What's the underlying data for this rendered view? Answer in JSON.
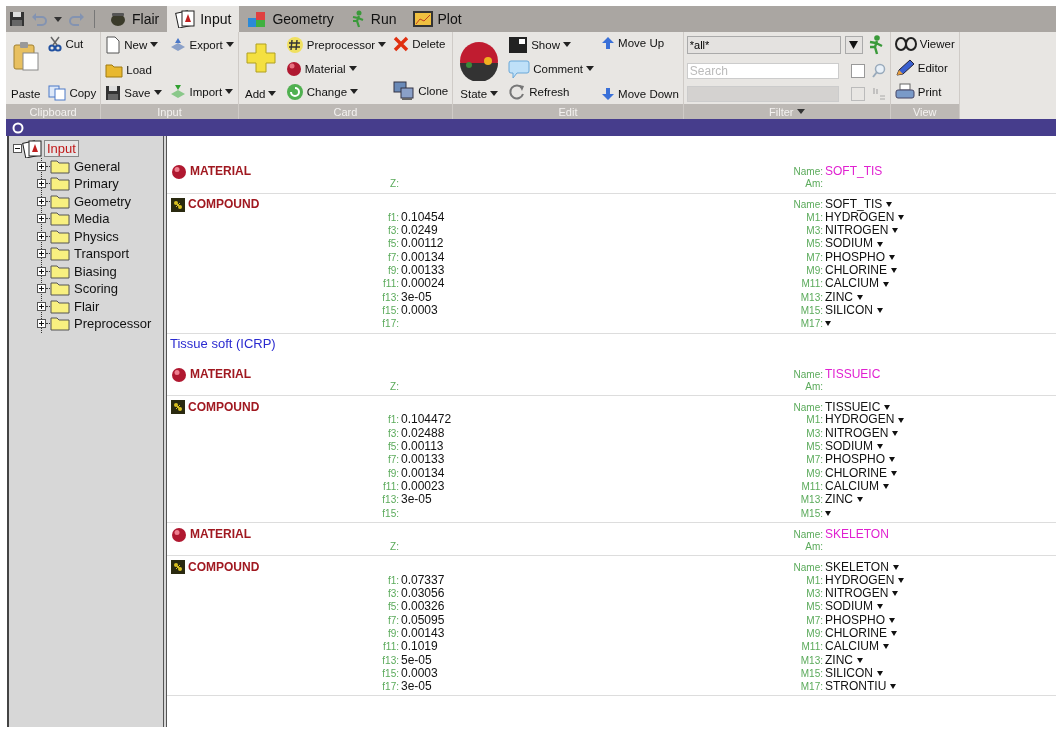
{
  "quick_access": [
    {
      "kind": "save",
      "disabled": false
    },
    {
      "kind": "undo",
      "disabled": true
    },
    {
      "kind": "dropdown",
      "disabled": false
    },
    {
      "kind": "redo",
      "disabled": true
    }
  ],
  "tabs": [
    {
      "label": "Flair",
      "kind": "flair",
      "selected": false
    },
    {
      "label": "Input",
      "kind": "input",
      "selected": true
    },
    {
      "label": "Geometry",
      "kind": "geometry",
      "selected": false
    },
    {
      "label": "Run",
      "kind": "run",
      "selected": false
    },
    {
      "label": "Plot",
      "kind": "plot",
      "selected": false
    }
  ],
  "ribbon": {
    "groups": [
      {
        "label": "Clipboard",
        "kind": "buttons",
        "columns": [
          [
            {
              "label": "Paste",
              "kind": "paste",
              "large": true,
              "dropdown": false
            }
          ],
          [
            {
              "label": "Cut",
              "kind": "cut",
              "large": false,
              "dropdown": false
            },
            {
              "label": "Copy",
              "kind": "copy",
              "large": false,
              "dropdown": false
            }
          ]
        ]
      },
      {
        "label": "Input",
        "kind": "buttons",
        "columns": [
          [
            {
              "label": "New",
              "kind": "new",
              "large": false,
              "dropdown": true
            },
            {
              "label": "Load",
              "kind": "load",
              "large": false,
              "dropdown": false
            },
            {
              "label": "Save",
              "kind": "save",
              "large": false,
              "dropdown": true
            }
          ],
          [
            {
              "label": "Export",
              "kind": "export",
              "large": false,
              "dropdown": true
            },
            {
              "label": "Import",
              "kind": "import",
              "large": false,
              "dropdown": true
            }
          ]
        ]
      },
      {
        "label": "Card",
        "kind": "buttons",
        "columns": [
          [
            {
              "label": "Add",
              "kind": "add",
              "large": true,
              "dropdown": true
            }
          ],
          [
            {
              "label": "Preprocessor",
              "kind": "preprocessor",
              "large": false,
              "dropdown": true
            },
            {
              "label": "Material",
              "kind": "material",
              "large": false,
              "dropdown": true
            },
            {
              "label": "Change",
              "kind": "change",
              "large": false,
              "dropdown": true
            }
          ],
          [
            {
              "label": "Delete",
              "kind": "delete",
              "large": false,
              "dropdown": false
            },
            {
              "label": "Clone",
              "kind": "clone",
              "large": false,
              "dropdown": false
            }
          ]
        ]
      },
      {
        "label": "Edit",
        "kind": "buttons",
        "columns": [
          [
            {
              "label": "State",
              "kind": "state",
              "large": true,
              "dropdown": true
            }
          ],
          [
            {
              "label": "Show",
              "kind": "show",
              "large": false,
              "dropdown": true
            },
            {
              "label": "Comment",
              "kind": "comment",
              "large": false,
              "dropdown": true
            },
            {
              "label": "Refresh",
              "kind": "refresh",
              "large": false,
              "dropdown": false
            }
          ],
          [
            {
              "label": "Move Up",
              "kind": "move-up",
              "large": false,
              "dropdown": false
            },
            {
              "label": "Move Down",
              "kind": "move-down",
              "large": false,
              "dropdown": false
            }
          ]
        ]
      },
      {
        "label": "Filter",
        "kind": "filter",
        "dropdown": true,
        "combo": {
          "value": "*all*"
        },
        "search": {
          "placeholder": "Search",
          "checked": false
        },
        "pattern": {
          "disabled": true,
          "checked": false
        }
      },
      {
        "label": "View",
        "kind": "buttons",
        "columns": [
          [
            {
              "label": "Viewer",
              "kind": "viewer",
              "large": false,
              "dropdown": false
            },
            {
              "label": "Editor",
              "kind": "editor",
              "large": false,
              "dropdown": false
            },
            {
              "label": "Print",
              "kind": "print",
              "large": false,
              "dropdown": false
            }
          ]
        ]
      }
    ]
  },
  "tree": {
    "label": "Input",
    "expanded": true,
    "selected": true,
    "children": [
      {
        "label": "General",
        "expanded": false,
        "selected": false
      },
      {
        "label": "Primary",
        "expanded": false,
        "selected": false
      },
      {
        "label": "Geometry",
        "expanded": false,
        "selected": false
      },
      {
        "label": "Media",
        "expanded": false,
        "selected": false
      },
      {
        "label": "Physics",
        "expanded": false,
        "selected": false
      },
      {
        "label": "Transport",
        "expanded": false,
        "selected": false
      },
      {
        "label": "Biasing",
        "expanded": false,
        "selected": false
      },
      {
        "label": "Scoring",
        "expanded": false,
        "selected": false
      },
      {
        "label": "Flair",
        "expanded": false,
        "selected": false
      },
      {
        "label": "Preprocessor",
        "expanded": false,
        "selected": false
      }
    ]
  },
  "cards": [
    {
      "kind": "material",
      "title": "MATERIAL",
      "lines": [
        {
          "right": {
            "label": "Name:",
            "value": "SOFT_TIS",
            "kind": "name"
          }
        },
        {
          "mid": {
            "label": "Z:"
          },
          "right": {
            "label": "Am:",
            "kind": "plain"
          }
        }
      ]
    },
    {
      "kind": "compound",
      "title": "COMPOUND",
      "lines": [
        {
          "right": {
            "label": "Name:",
            "value": "SOFT_TIS",
            "kind": "select"
          }
        },
        {
          "mid": {
            "label": "f1:",
            "value": "0.10454"
          },
          "right": {
            "label": "M1:",
            "value": "HYDROGEN",
            "kind": "select"
          }
        },
        {
          "mid": {
            "label": "f3:",
            "value": "0.0249"
          },
          "right": {
            "label": "M3:",
            "value": "NITROGEN",
            "kind": "select"
          }
        },
        {
          "mid": {
            "label": "f5:",
            "value": "0.00112"
          },
          "right": {
            "label": "M5:",
            "value": "SODIUM",
            "kind": "select"
          }
        },
        {
          "mid": {
            "label": "f7:",
            "value": "0.00134"
          },
          "right": {
            "label": "M7:",
            "value": "PHOSPHO",
            "kind": "select"
          }
        },
        {
          "mid": {
            "label": "f9:",
            "value": "0.00133"
          },
          "right": {
            "label": "M9:",
            "value": "CHLORINE",
            "kind": "select"
          }
        },
        {
          "mid": {
            "label": "f11:",
            "value": "0.00024"
          },
          "right": {
            "label": "M11:",
            "value": "CALCIUM",
            "kind": "select"
          }
        },
        {
          "mid": {
            "label": "f13:",
            "value": "3e-05"
          },
          "right": {
            "label": "M13:",
            "value": "ZINC",
            "kind": "select"
          }
        },
        {
          "mid": {
            "label": "f15:",
            "value": "0.0003"
          },
          "right": {
            "label": "M15:",
            "value": "SILICON",
            "kind": "select"
          }
        },
        {
          "mid": {
            "label": "f17:"
          },
          "right": {
            "label": "M17:",
            "kind": "select"
          }
        }
      ]
    },
    {
      "kind": "comment",
      "text": "Tissue soft (ICRP)"
    },
    {
      "kind": "material",
      "title": "MATERIAL",
      "lines": [
        {
          "right": {
            "label": "Name:",
            "value": "TISSUEIC",
            "kind": "name"
          }
        },
        {
          "mid": {
            "label": "Z:"
          },
          "right": {
            "label": "Am:",
            "kind": "plain"
          }
        }
      ]
    },
    {
      "kind": "compound",
      "title": "COMPOUND",
      "lines": [
        {
          "right": {
            "label": "Name:",
            "value": "TISSUEIC",
            "kind": "select"
          }
        },
        {
          "mid": {
            "label": "f1:",
            "value": "0.104472"
          },
          "right": {
            "label": "M1:",
            "value": "HYDROGEN",
            "kind": "select"
          }
        },
        {
          "mid": {
            "label": "f3:",
            "value": "0.02488"
          },
          "right": {
            "label": "M3:",
            "value": "NITROGEN",
            "kind": "select"
          }
        },
        {
          "mid": {
            "label": "f5:",
            "value": "0.00113"
          },
          "right": {
            "label": "M5:",
            "value": "SODIUM",
            "kind": "select"
          }
        },
        {
          "mid": {
            "label": "f7:",
            "value": "0.00133"
          },
          "right": {
            "label": "M7:",
            "value": "PHOSPHO",
            "kind": "select"
          }
        },
        {
          "mid": {
            "label": "f9:",
            "value": "0.00134"
          },
          "right": {
            "label": "M9:",
            "value": "CHLORINE",
            "kind": "select"
          }
        },
        {
          "mid": {
            "label": "f11:",
            "value": "0.00023"
          },
          "right": {
            "label": "M11:",
            "value": "CALCIUM",
            "kind": "select"
          }
        },
        {
          "mid": {
            "label": "f13:",
            "value": "3e-05"
          },
          "right": {
            "label": "M13:",
            "value": "ZINC",
            "kind": "select"
          }
        },
        {
          "mid": {
            "label": "f15:"
          },
          "right": {
            "label": "M15:",
            "kind": "select"
          }
        }
      ]
    },
    {
      "kind": "material",
      "title": "MATERIAL",
      "lines": [
        {
          "right": {
            "label": "Name:",
            "value": "SKELETON",
            "kind": "name"
          }
        },
        {
          "mid": {
            "label": "Z:"
          },
          "right": {
            "label": "Am:",
            "kind": "plain"
          }
        }
      ]
    },
    {
      "kind": "compound",
      "title": "COMPOUND",
      "lines": [
        {
          "right": {
            "label": "Name:",
            "value": "SKELETON",
            "kind": "select"
          }
        },
        {
          "mid": {
            "label": "f1:",
            "value": "0.07337"
          },
          "right": {
            "label": "M1:",
            "value": "HYDROGEN",
            "kind": "select"
          }
        },
        {
          "mid": {
            "label": "f3:",
            "value": "0.03056"
          },
          "right": {
            "label": "M3:",
            "value": "NITROGEN",
            "kind": "select"
          }
        },
        {
          "mid": {
            "label": "f5:",
            "value": "0.00326"
          },
          "right": {
            "label": "M5:",
            "value": "SODIUM",
            "kind": "select"
          }
        },
        {
          "mid": {
            "label": "f7:",
            "value": "0.05095"
          },
          "right": {
            "label": "M7:",
            "value": "PHOSPHO",
            "kind": "select"
          }
        },
        {
          "mid": {
            "label": "f9:",
            "value": "0.00143"
          },
          "right": {
            "label": "M9:",
            "value": "CHLORINE",
            "kind": "select"
          }
        },
        {
          "mid": {
            "label": "f11:",
            "value": "0.1019"
          },
          "right": {
            "label": "M11:",
            "value": "CALCIUM",
            "kind": "select"
          }
        },
        {
          "mid": {
            "label": "f13:",
            "value": "5e-05"
          },
          "right": {
            "label": "M13:",
            "value": "ZINC",
            "kind": "select"
          }
        },
        {
          "mid": {
            "label": "f15:",
            "value": "0.0003"
          },
          "right": {
            "label": "M15:",
            "value": "SILICON",
            "kind": "select"
          }
        },
        {
          "mid": {
            "label": "f17:",
            "value": "3e-05"
          },
          "right": {
            "label": "M17:",
            "value": "STRONTIU",
            "kind": "select"
          }
        }
      ]
    }
  ]
}
